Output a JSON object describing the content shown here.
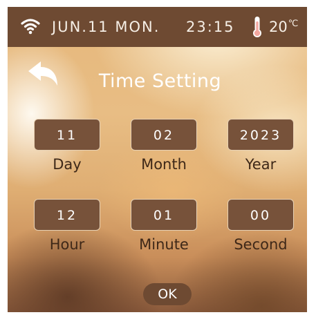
{
  "status": {
    "wifi_icon": "wifi-icon",
    "date": "JUN.11 MON.",
    "time": "23:15",
    "thermometer_icon": "thermometer-icon",
    "temperature": "20",
    "temperature_unit": "℃"
  },
  "header": {
    "back_icon": "back-arrow-icon",
    "title": "Time Setting"
  },
  "fields": {
    "day": {
      "value": "11",
      "label": "Day"
    },
    "month": {
      "value": "02",
      "label": "Month"
    },
    "year": {
      "value": "2023",
      "label": "Year"
    },
    "hour": {
      "value": "12",
      "label": "Hour"
    },
    "minute": {
      "value": "01",
      "label": "Minute"
    },
    "second": {
      "value": "00",
      "label": "Second"
    }
  },
  "ok_label": "OK",
  "colors": {
    "statusbar": "#6e4a32",
    "field_box": "#77523a",
    "label_text": "#3e2818",
    "thermometer": "#f2a7a0"
  }
}
